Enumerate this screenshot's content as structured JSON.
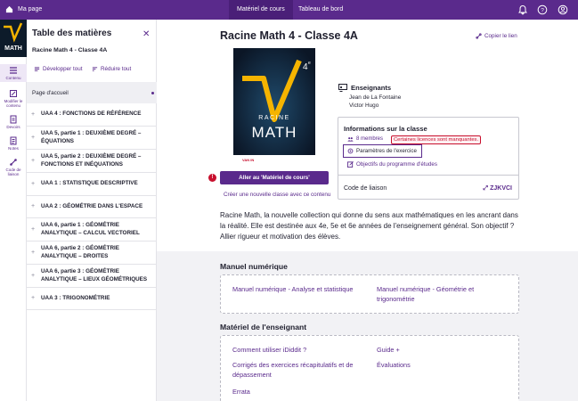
{
  "topbar": {
    "home_label": "Ma page",
    "tabs": [
      "Matériel de cours",
      "Tableau de bord"
    ],
    "icons": [
      "bell-icon",
      "help-icon",
      "user-icon"
    ]
  },
  "rail": {
    "cover_text": "MATH",
    "items": [
      {
        "label": "Contenu",
        "icon": "list-icon"
      },
      {
        "label": "Modifier le contenu",
        "icon": "edit-icon"
      },
      {
        "label": "Devoirs",
        "icon": "tasks-icon"
      },
      {
        "label": "Notes",
        "icon": "notes-icon"
      },
      {
        "label": "Code de liaison",
        "icon": "link-icon"
      }
    ]
  },
  "toc": {
    "title": "Table des matières",
    "subtitle": "Racine Math 4 - Classe 4A",
    "expand_all": "Développer tout",
    "collapse_all": "Réduire tout",
    "home_item": "Page d'accueil",
    "items": [
      "UAA 4 : FONCTIONS DE RÉFÉRENCE",
      "UAA 5, partie 1 : DEUXIÈME DEGRÉ – ÉQUATIONS",
      "UAA 5, partie 2 : DEUXIÈME DEGRÉ – FONCTIONS ET INÉQUATIONS",
      "UAA 1 : STATISTIQUE DESCRIPTIVE",
      "UAA 2 : GÉOMÉTRIE DANS L'ESPACE",
      "UAA 6, partie 1 : GÉOMÉTRIE ANALYTIQUE – CALCUL VECTORIEL",
      "UAA 6, partie 2 : GÉOMÉTRIE ANALYTIQUE – DROITES",
      "UAA 6, partie 3 : GÉOMÉTRIE ANALYTIQUE – LIEUX GÉOMÉTRIQUES",
      "UAA 3 : TRIGONOMÉTRIE"
    ]
  },
  "main": {
    "title": "Racine Math 4 - Classe 4A",
    "copy_link": "Copier le lien",
    "book": {
      "line1": "RACINE",
      "line2": "MATH",
      "grade": "4",
      "grade_sup": "e",
      "publisher": "VAN IN"
    },
    "go_button": "Aller au 'Matériel de cours'",
    "create_link": "Créer une nouvelle classe avec ce contenu",
    "teachers": {
      "heading": "Enseignants",
      "names": [
        "Jean de La Fontaine",
        "Victor Hugo"
      ]
    },
    "class_info": {
      "heading": "Informations sur la classe",
      "members": "8 membres",
      "warning": "Certaines licences sont manquantes.",
      "exercise_settings": "Paramètres de l'exercice",
      "objectives": "Objectifs du programme d'études",
      "code_label": "Code de liaison",
      "code_value": "ZJKVCI"
    },
    "description": "Racine Math, la nouvelle collection qui donne du sens aux mathématiques en les ancrant dans la réalité. Elle est destinée aux 4e, 5e et 6e années de l'enseignement général. Son objectif ? Allier rigueur et motivation des élèves.",
    "digital": {
      "title": "Manuel numérique",
      "links": [
        "Manuel numérique - Analyse et statistique",
        "Manuel numérique - Géométrie et trigonométrie"
      ]
    },
    "teacher_material": {
      "title": "Matériel de l'enseignant",
      "links": [
        "Comment utiliser iDiddit ?",
        "Guide +",
        "Corrigés des exercices récapitulatifs et de dépassement",
        "Évaluations",
        "Errata"
      ]
    }
  },
  "colors": {
    "brand": "#5a2a8c",
    "warning": "#c8102e",
    "book_accent": "#f5b400"
  }
}
